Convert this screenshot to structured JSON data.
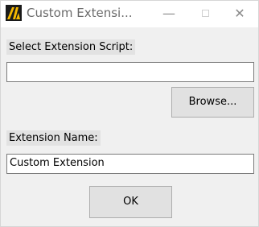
{
  "window": {
    "title": "Custom Extensi...",
    "controls": {
      "minimize": "—",
      "close": "✕"
    }
  },
  "script_section": {
    "label": "Select Extension Script:",
    "path_value": "",
    "browse_label": "Browse..."
  },
  "name_section": {
    "label": "Extension Name:",
    "name_value": "Custom Extension"
  },
  "ok_label": "OK",
  "icons": {
    "app": "app-logo-icon",
    "minimize": "minimize-icon",
    "maximize": "maximize-icon",
    "close": "close-icon"
  },
  "colors": {
    "titlebar": "#ffffff",
    "dialog": "#f0f0f0",
    "button": "#e1e1e1",
    "icon_accent": "#f5b800"
  }
}
